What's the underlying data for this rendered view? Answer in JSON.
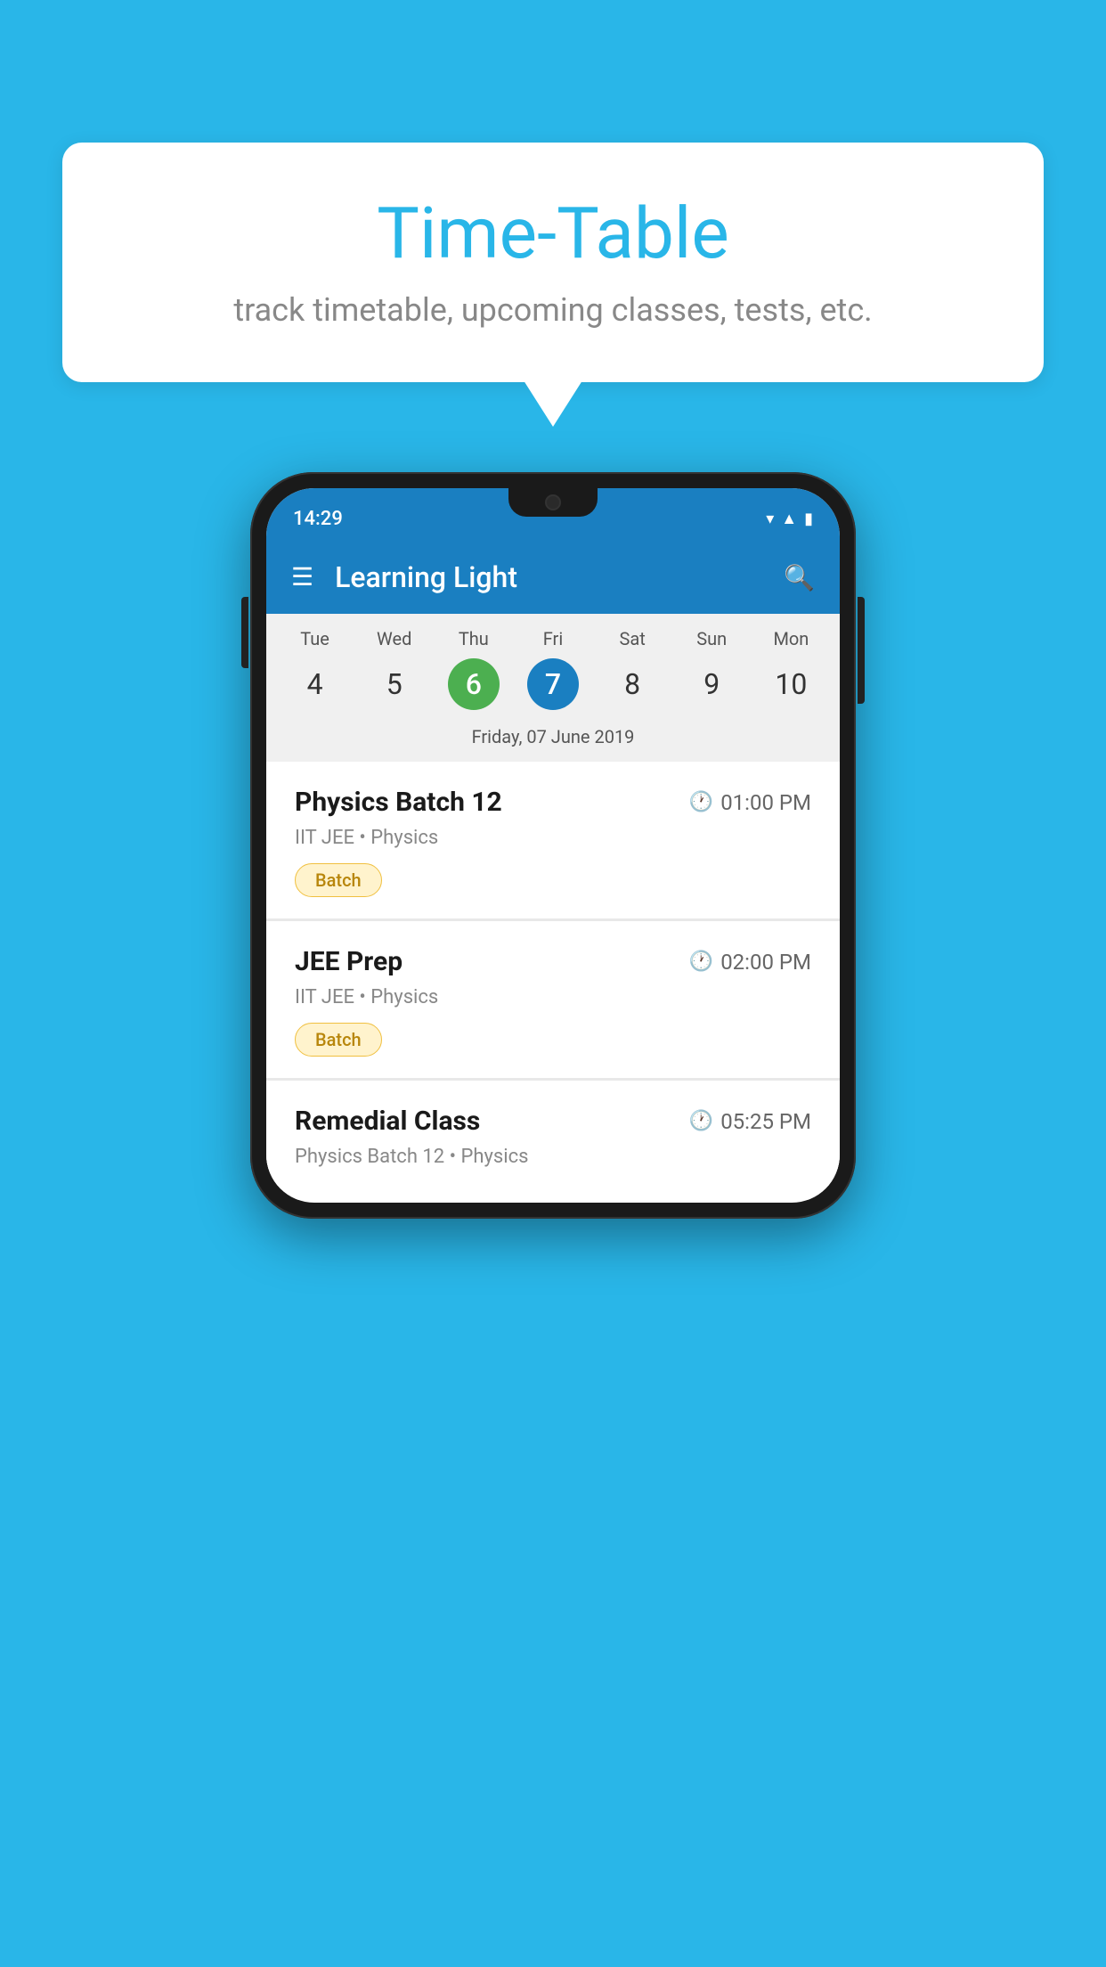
{
  "background_color": "#29b6e8",
  "bubble": {
    "title": "Time-Table",
    "subtitle": "track timetable, upcoming classes, tests, etc."
  },
  "phone": {
    "status_bar": {
      "time": "14:29",
      "icons": [
        "wifi",
        "signal",
        "battery"
      ]
    },
    "app_bar": {
      "title": "Learning Light",
      "menu_icon": "☰",
      "search_icon": "🔍"
    },
    "week": {
      "days": [
        {
          "label": "Tue",
          "num": "4",
          "state": "normal"
        },
        {
          "label": "Wed",
          "num": "5",
          "state": "normal"
        },
        {
          "label": "Thu",
          "num": "6",
          "state": "today"
        },
        {
          "label": "Fri",
          "num": "7",
          "state": "selected"
        },
        {
          "label": "Sat",
          "num": "8",
          "state": "normal"
        },
        {
          "label": "Sun",
          "num": "9",
          "state": "normal"
        },
        {
          "label": "Mon",
          "num": "10",
          "state": "normal"
        }
      ],
      "selected_date_label": "Friday, 07 June 2019"
    },
    "schedule": [
      {
        "title": "Physics Batch 12",
        "time": "01:00 PM",
        "subtitle": "IIT JEE • Physics",
        "badge": "Batch"
      },
      {
        "title": "JEE Prep",
        "time": "02:00 PM",
        "subtitle": "IIT JEE • Physics",
        "badge": "Batch"
      },
      {
        "title": "Remedial Class",
        "time": "05:25 PM",
        "subtitle": "Physics Batch 12 • Physics",
        "badge": null
      }
    ]
  }
}
